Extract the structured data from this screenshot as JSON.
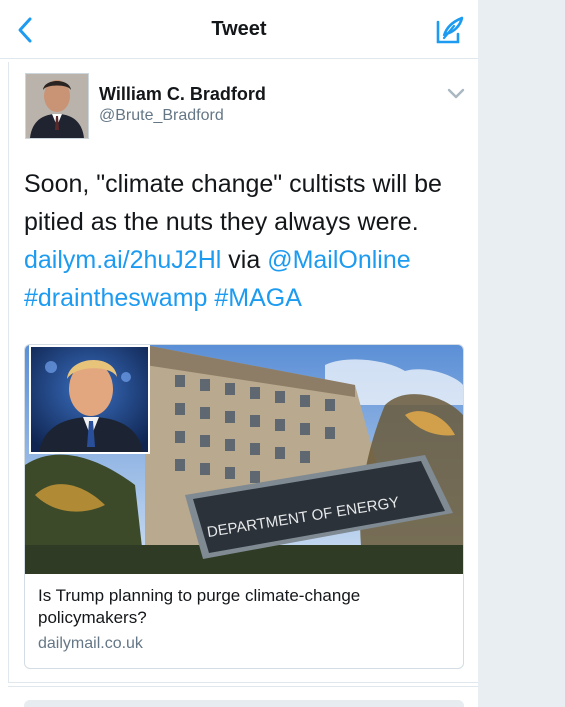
{
  "header": {
    "title": "Tweet"
  },
  "icons": {
    "back": "chevron-left-icon",
    "compose": "compose-feather-icon",
    "menu": "chevron-down-icon"
  },
  "colors": {
    "accent": "#1d9bf0",
    "text": "#14171a",
    "secondary": "#657786"
  },
  "author": {
    "name": "William C. Bradford",
    "handle": "@Brute_Bradford"
  },
  "tweet": {
    "line1": "Soon, \"climate change\" cultists will be pitied as the nuts they always were.",
    "link": "dailym.ai/2huJ2Hl",
    "via": " via ",
    "mention": "@MailOnline",
    "hashtag1": "#draintheswamp",
    "hashtag2": "#MAGA"
  },
  "card": {
    "sign_text": "DEPARTMENT OF ENERGY",
    "title": "Is Trump planning to purge climate-change policymakers?",
    "domain": "dailymail.co.uk"
  }
}
